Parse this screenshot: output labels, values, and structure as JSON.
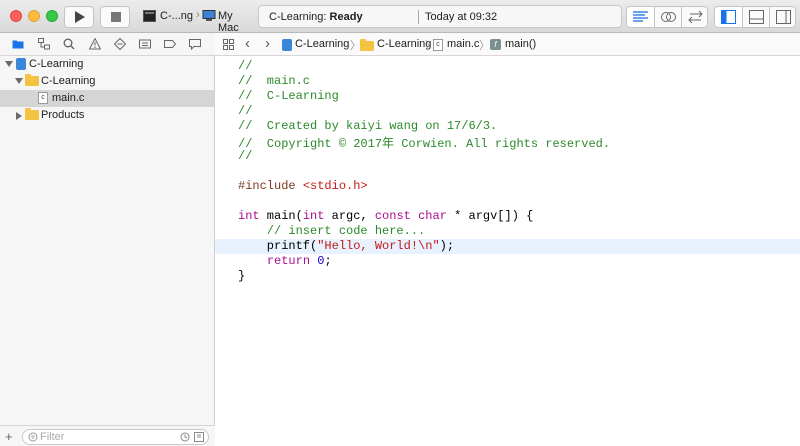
{
  "toolbar": {
    "scheme_name": "C-...ng",
    "destination": "My Mac",
    "activity_project": "C-Learning: ",
    "activity_status": "Ready",
    "activity_time": "Today at 09:32"
  },
  "breadcrumb": [
    "C-Learning",
    "C-Learning",
    "main.c",
    "main()"
  ],
  "navigator": {
    "items": [
      {
        "label": "C-Learning",
        "kind": "project"
      },
      {
        "label": "C-Learning",
        "kind": "folder"
      },
      {
        "label": "main.c",
        "kind": "c-file"
      },
      {
        "label": "Products",
        "kind": "folder"
      }
    ],
    "filter_placeholder": "Filter"
  },
  "code": {
    "l1": "//",
    "l2": "//  main.c",
    "l3": "//  C-Learning",
    "l4": "//",
    "l5": "//  Created by kaiyi wang on 17/6/3.",
    "l6": "//  Copyright © 2017年 Corwien. All rights reserved.",
    "l7": "//",
    "l9_a": "#include ",
    "l9_b": "<stdio.h>",
    "l11_a": "int",
    "l11_b": " main(",
    "l11_c": "int",
    "l11_d": " argc, ",
    "l11_e": "const",
    "l11_f": " ",
    "l11_g": "char",
    "l11_h": " * argv[]) {",
    "l12": "    // insert code here...",
    "l13_a": "    printf(",
    "l13_b": "\"Hello, World!\\n\"",
    "l13_c": ");",
    "l14_a": "    ",
    "l14_b": "return",
    "l14_c": " ",
    "l14_d": "0",
    "l14_e": ";",
    "l15": "}"
  },
  "colors": {
    "comment": "#2b8a2b",
    "keyword": "#aa0d91",
    "string": "#c41a16",
    "number": "#1c00cf",
    "preprocessor": "#7b3a1f",
    "accent": "#1a73e8"
  }
}
